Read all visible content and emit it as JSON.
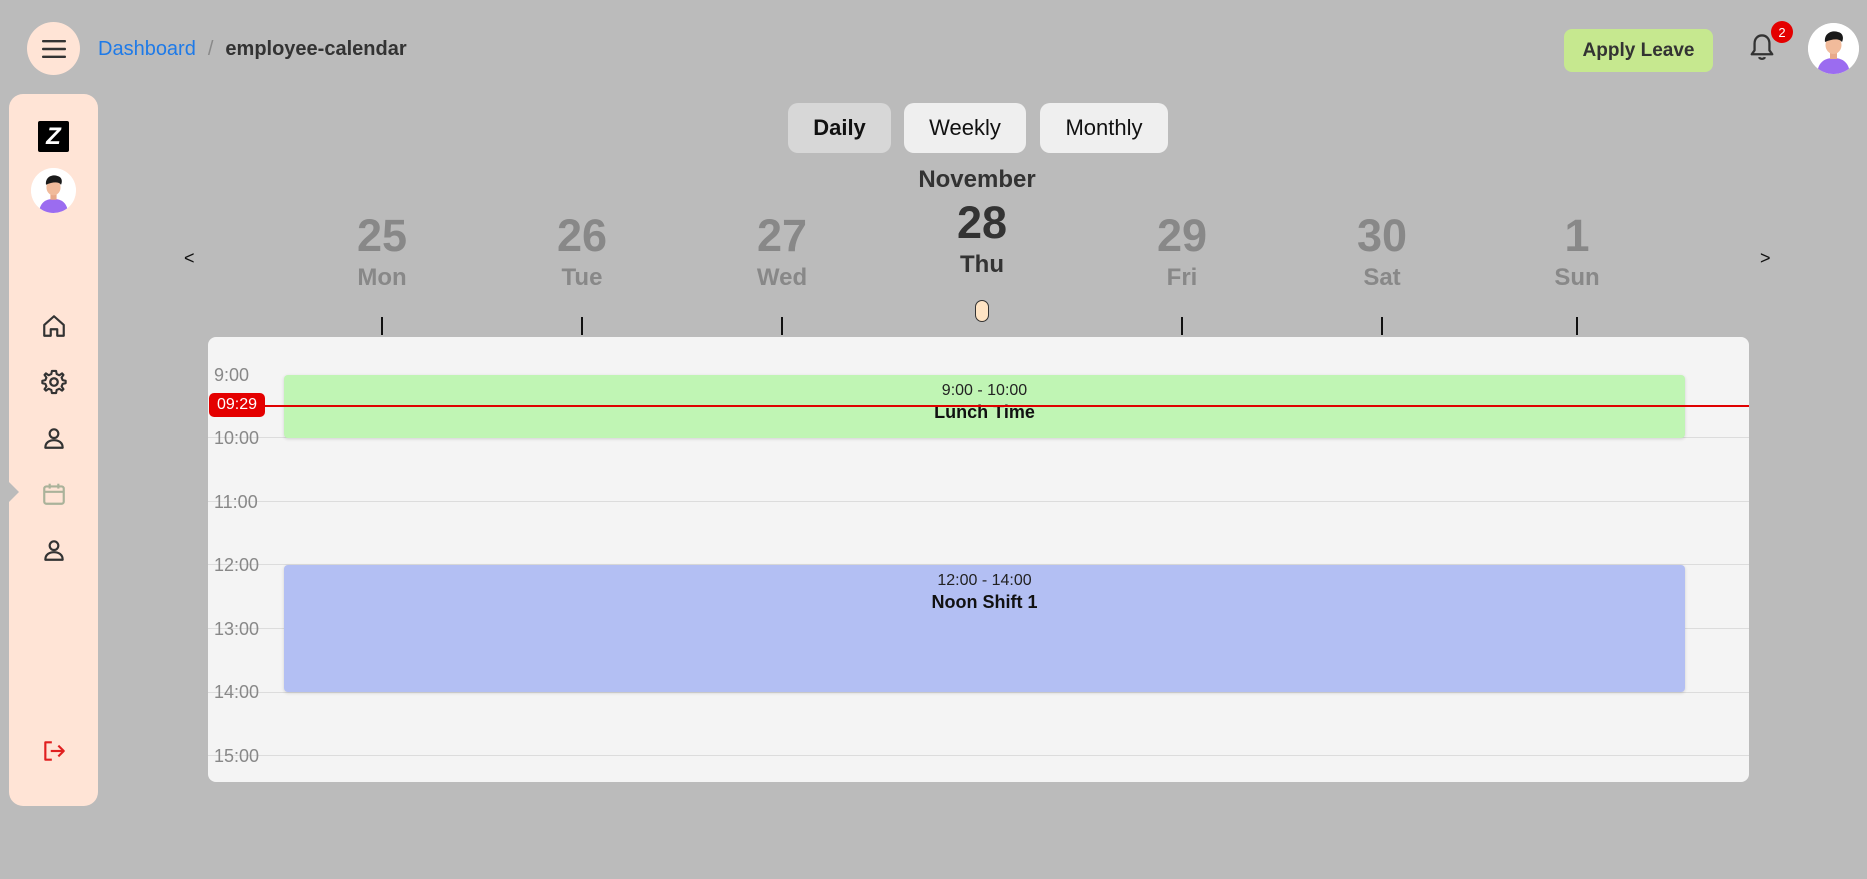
{
  "header": {
    "breadcrumb": {
      "link": "Dashboard",
      "separator": "/",
      "current": "employee-calendar"
    },
    "apply_leave_label": "Apply Leave",
    "notification_count": "2"
  },
  "sidebar": {
    "logo_text": "Z",
    "items": [
      {
        "icon": "home-icon"
      },
      {
        "icon": "gear-icon"
      },
      {
        "icon": "user-icon"
      },
      {
        "icon": "calendar-icon",
        "active": true
      },
      {
        "icon": "user-icon"
      }
    ],
    "logout_icon": "logout-icon"
  },
  "view_toggle": {
    "daily": "Daily",
    "weekly": "Weekly",
    "monthly": "Monthly",
    "selected": "Daily"
  },
  "date_strip": {
    "month": "November",
    "prev": "<",
    "next": ">",
    "days": [
      {
        "num": "25",
        "dow": "Mon"
      },
      {
        "num": "26",
        "dow": "Tue"
      },
      {
        "num": "27",
        "dow": "Wed"
      },
      {
        "num": "28",
        "dow": "Thu",
        "current": true
      },
      {
        "num": "29",
        "dow": "Fri"
      },
      {
        "num": "30",
        "dow": "Sat"
      },
      {
        "num": "1",
        "dow": "Sun"
      }
    ]
  },
  "calendar": {
    "hours": [
      "9:00",
      "10:00",
      "11:00",
      "12:00",
      "13:00",
      "14:00",
      "15:00"
    ],
    "now": "09:29",
    "events": [
      {
        "time": "9:00 - 10:00",
        "title": "Lunch Time",
        "color": "#c0f5b4"
      },
      {
        "time": "12:00 - 14:00",
        "title": "Noon Shift 1",
        "color": "#b3bff3"
      }
    ]
  },
  "colors": {
    "sidebar_bg": "#ffe4d6",
    "accent_link": "#1e7ae8",
    "apply_btn": "#c6e88f",
    "now_red": "#e40000"
  }
}
